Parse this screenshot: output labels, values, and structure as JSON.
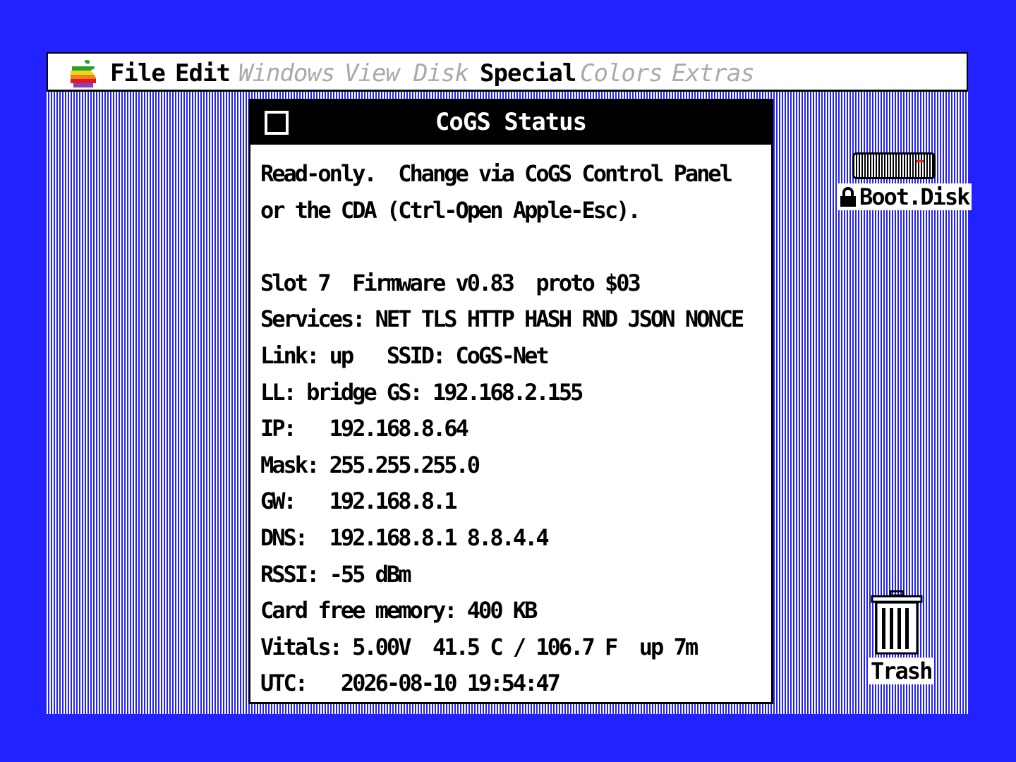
{
  "menubar": {
    "items": [
      {
        "label": "File",
        "enabled": true
      },
      {
        "label": "Edit",
        "enabled": true
      },
      {
        "label": "Windows",
        "enabled": false
      },
      {
        "label": "View",
        "enabled": false
      },
      {
        "label": "Disk",
        "enabled": false
      },
      {
        "label": "Special",
        "enabled": true
      },
      {
        "label": "Colors",
        "enabled": false
      },
      {
        "label": "Extras",
        "enabled": false
      }
    ]
  },
  "window": {
    "title": "CoGS Status",
    "lines": [
      "Read-only.  Change via CoGS Control Panel",
      "or the CDA (Ctrl-Open Apple-Esc).",
      "",
      "Slot 7  Firmware v0.83  proto $03",
      "Services: NET TLS HTTP HASH RND JSON NONCE",
      "Link: up   SSID: CoGS-Net",
      "LL: bridge GS: 192.168.2.155",
      "IP:   192.168.8.64",
      "Mask: 255.255.255.0",
      "GW:   192.168.8.1",
      "DNS:  192.168.8.1 8.8.4.4",
      "RSSI: -55 dBm",
      "Card free memory: 400 KB",
      "Vitals: 5.00V  41.5 C / 106.7 F  up 7m",
      "UTC:   2026-08-10 19:54:47"
    ]
  },
  "desktop": {
    "boot_disk_label": "Boot.Disk",
    "trash_label": "Trash"
  },
  "colors": {
    "desktop_blue": "#2222ff",
    "window_bg": "#ffffff",
    "titlebar_bg": "#000000",
    "disabled_menu": "#aaaaaa"
  },
  "icons": {
    "apple_menu": "apple-rainbow-icon",
    "close_box": "close-box-icon",
    "boot_disk": "hard-disk-icon",
    "lock": "lock-icon",
    "trash": "trash-can-icon"
  }
}
